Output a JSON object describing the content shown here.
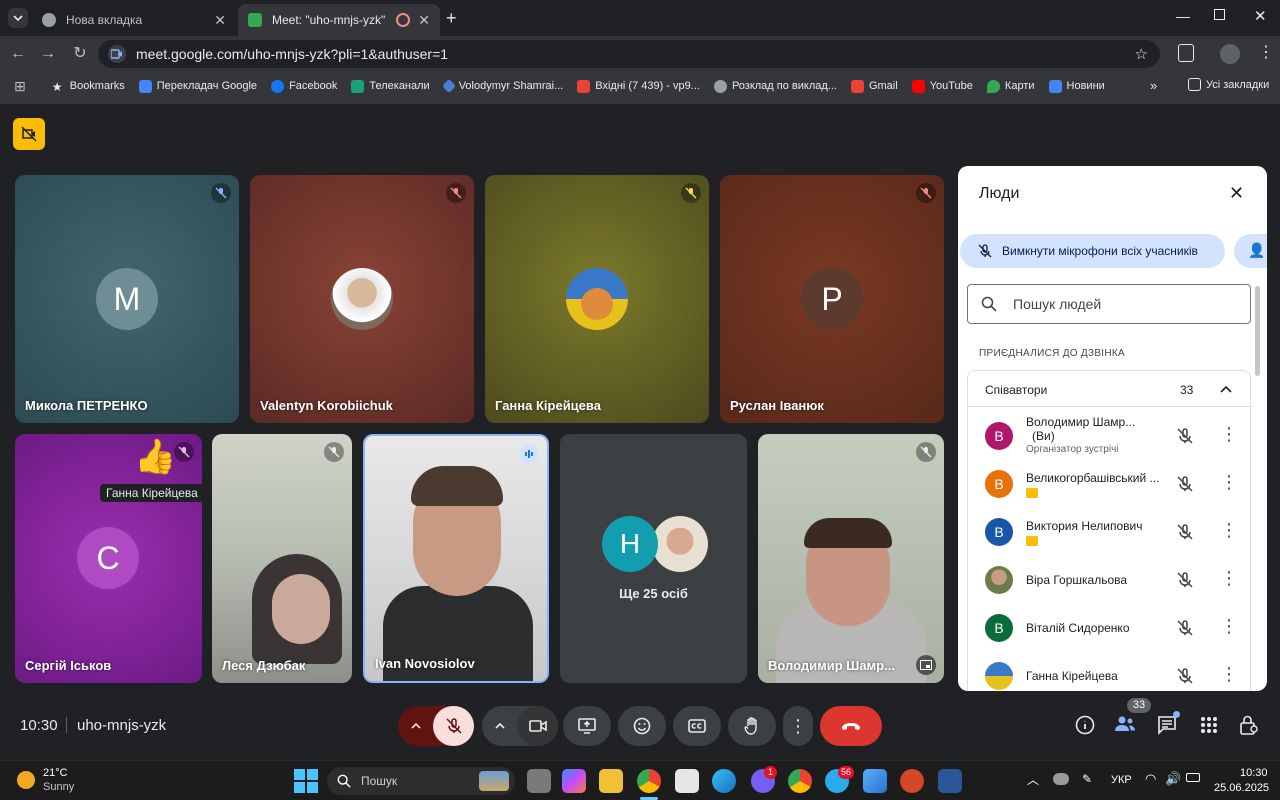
{
  "browser": {
    "tabs": [
      {
        "label": "Нова вкладка"
      },
      {
        "label": "Meet: \"uho-mnjs-yzk\""
      }
    ],
    "url": "meet.google.com/uho-mnjs-yzk?pli=1&authuser=1",
    "bookmarks": [
      {
        "label": "Bookmarks"
      },
      {
        "label": "Перекладач Google"
      },
      {
        "label": "Facebook"
      },
      {
        "label": "Телеканали"
      },
      {
        "label": "Volodymyr Shamrai..."
      },
      {
        "label": "Вхідні (7 439) - vp9..."
      },
      {
        "label": "Розклад по виклад..."
      },
      {
        "label": "Gmail"
      },
      {
        "label": "YouTube"
      },
      {
        "label": "Карти"
      },
      {
        "label": "Новини"
      }
    ],
    "all_bookmarks": "Усі закладки"
  },
  "meet": {
    "tiles": [
      {
        "name": "Микола ПЕТРЕНКО",
        "initial": "M"
      },
      {
        "name": "Valentyn Korobiichuk"
      },
      {
        "name": "Ганна Кірейцева"
      },
      {
        "name": "Руслан Іванюк",
        "initial": "P"
      },
      {
        "name": "Сергій Іськов",
        "initial": "C"
      },
      {
        "name": "Леся Дзюбак"
      },
      {
        "name": "Ivan Novosiolov"
      },
      {
        "name": "Володимир Шамр..."
      }
    ],
    "reaction_label": "Ганна Кірейцева",
    "more_initial": "H",
    "more_label": "Ще 25 осіб",
    "time": "10:30",
    "meeting_code": "uho-mnjs-yzk",
    "participants_badge": "33"
  },
  "people": {
    "title": "Люди",
    "mute_all": "Вимкнути мікрофони всіх учасників",
    "search_placeholder": "Пошук людей",
    "section": "ПРИЄДНАЛИСЯ ДО ДЗВІНКА",
    "group": "Співавтори",
    "group_count": "33",
    "participants": [
      {
        "name": "Володимир Шамр...",
        "you": "(Ви)",
        "sub": "Організатор зустрічі",
        "initial": "В",
        "color": "#b0176a"
      },
      {
        "name": "Великогорбашівський ...",
        "initial": "В",
        "color": "#e8710a"
      },
      {
        "name": "Виктория Нелипович",
        "initial": "В",
        "color": "#1a56a8"
      },
      {
        "name": "Віра Горшкальова",
        "initial": ""
      },
      {
        "name": "Віталій Сидоренко",
        "initial": "В",
        "color": "#0b6b3a"
      },
      {
        "name": "Ганна Кірейцева",
        "initial": ""
      }
    ]
  },
  "taskbar": {
    "weather_temp": "21°C",
    "weather_desc": "Sunny",
    "search": "Пошук",
    "lang": "УКР",
    "time": "10:30",
    "date": "25.06.2025",
    "viber_badge": "1",
    "telegram_badge": "56"
  }
}
